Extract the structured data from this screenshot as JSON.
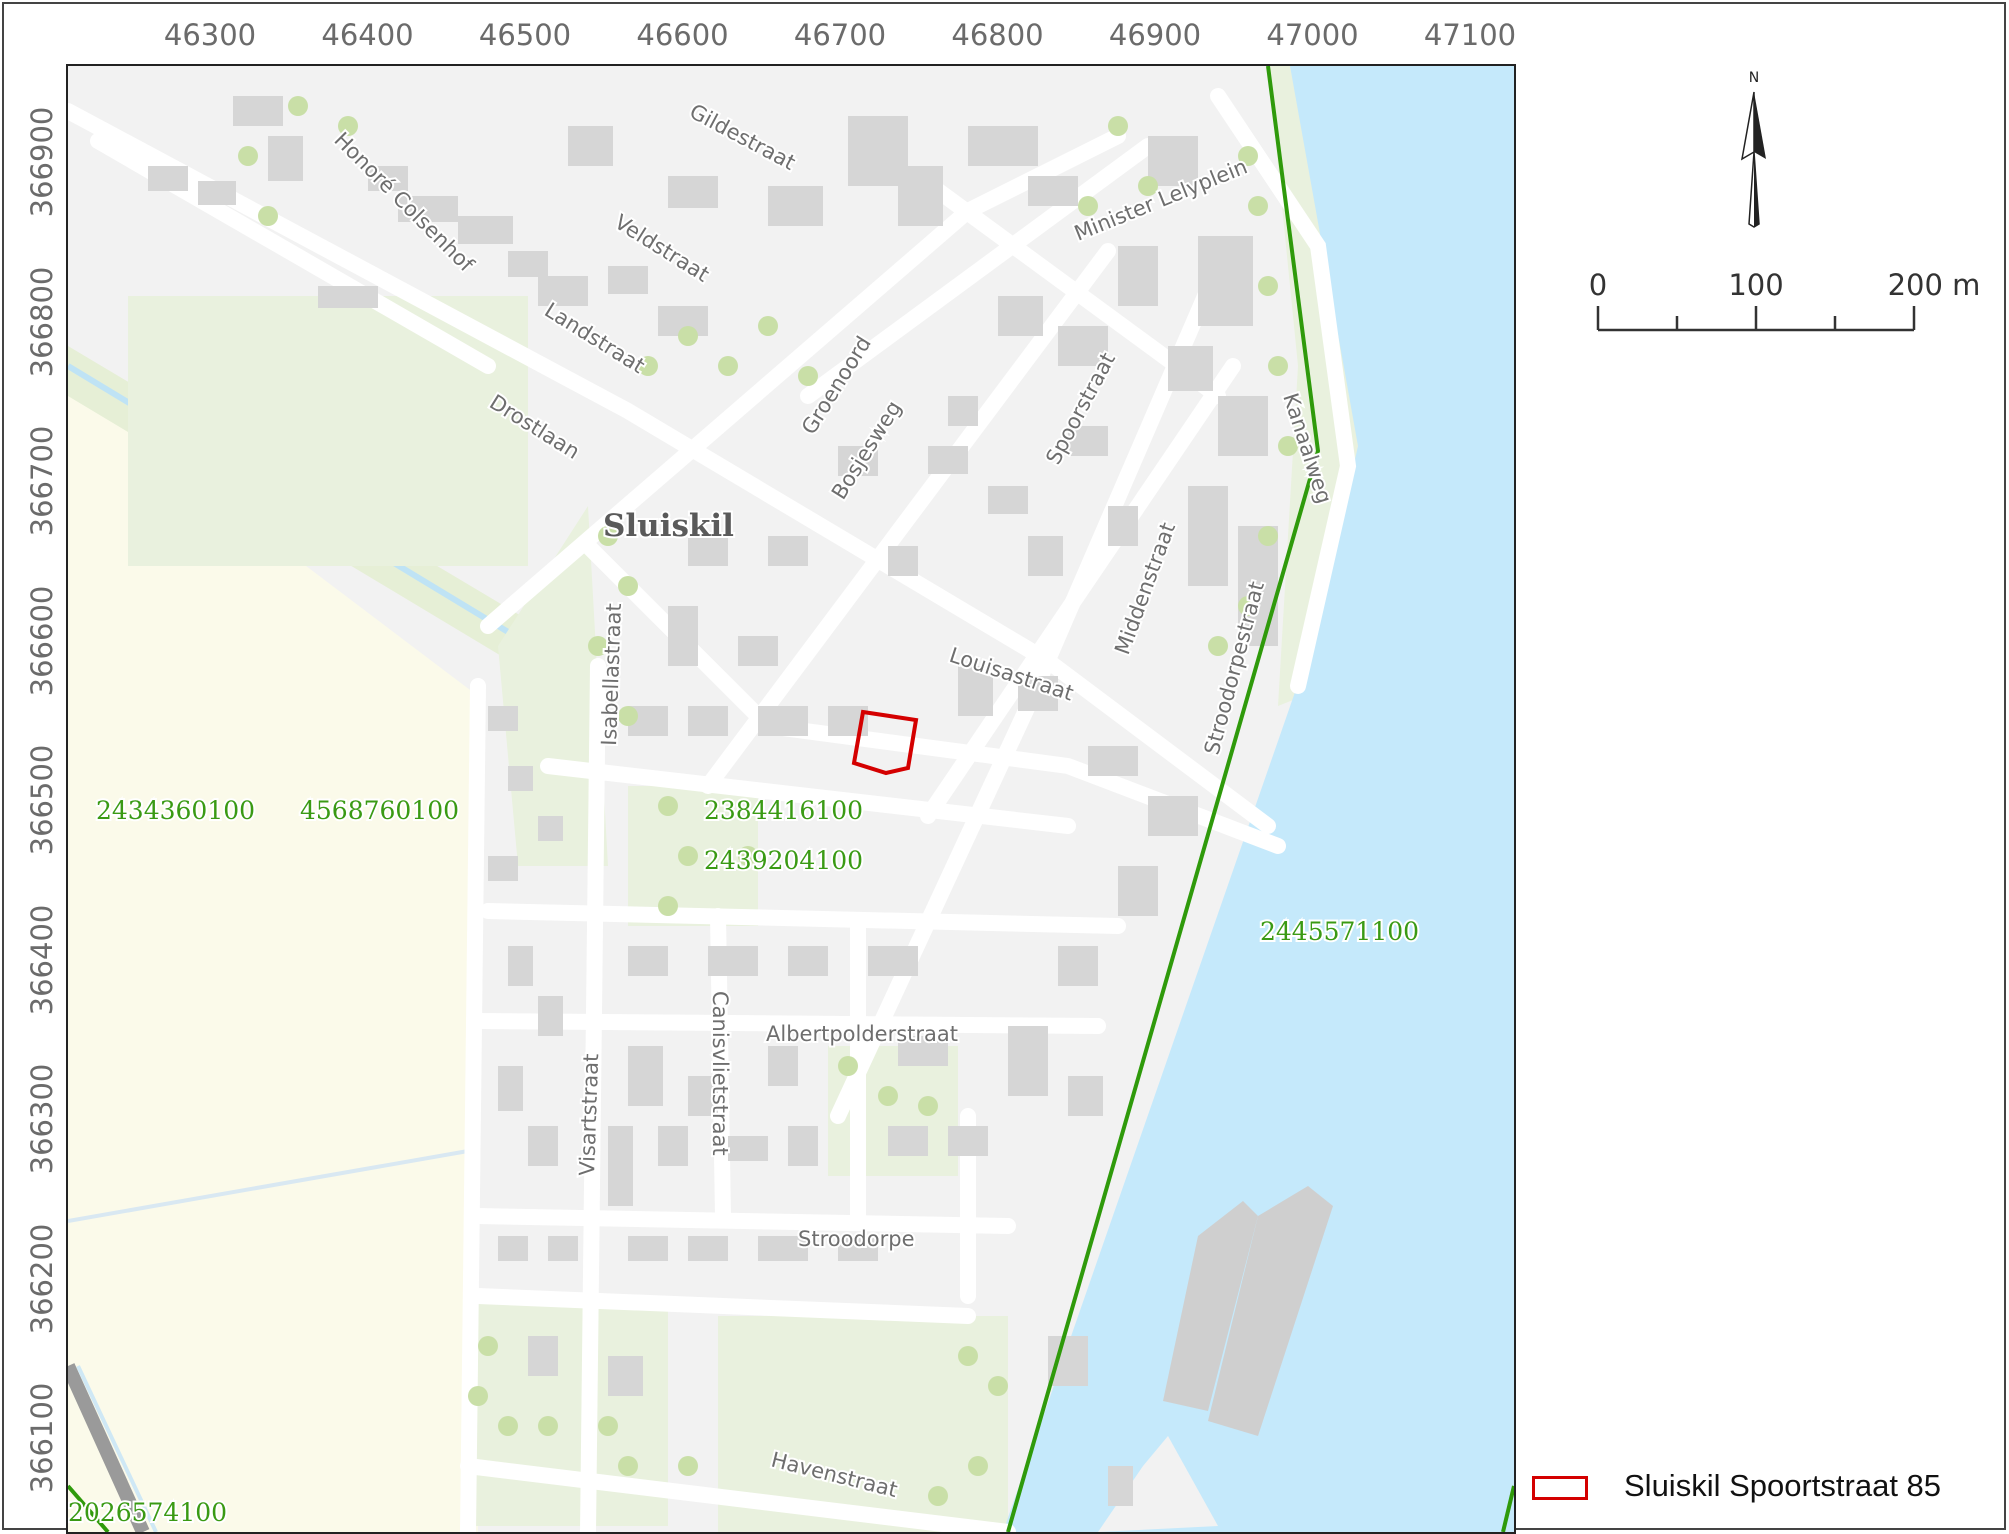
{
  "x_axis_ticks": [
    "46300",
    "46400",
    "46500",
    "46600",
    "46700",
    "46800",
    "46900",
    "47000",
    "47100"
  ],
  "y_axis_ticks": [
    "366900",
    "366800",
    "366700",
    "366600",
    "366500",
    "366400",
    "366300",
    "366200",
    "366100"
  ],
  "place_label": "Sluiskil",
  "street_labels": [
    "Gildestraat",
    "Honoré Colsenhof",
    "Veldstraat",
    "Landstraat",
    "Drostlaan",
    "Minister Lelyplein",
    "Groenoord",
    "Bosjesweg",
    "Spoorstraat",
    "Kanaalweg",
    "Middenstraat",
    "Louisastraat",
    "Isabellastraat",
    "Stroodorpestraat",
    "Visartstraat",
    "Canisvlietstraat",
    "Albertpolderstraat",
    "Stroodorpe",
    "Havenstraat"
  ],
  "parcel_labels": [
    "2434360100",
    "4568760100",
    "2384416100",
    "2439204100",
    "2445571100",
    "2026574100"
  ],
  "north_label": "N",
  "scale_labels": [
    "0",
    "100",
    "200 m"
  ],
  "legend": {
    "label": "Sluiskil Spoortstraat 85",
    "color": "#d40000"
  },
  "colors": {
    "water": "#c5e9fb",
    "built": "#f2f2f2",
    "building": "#d6d6d6",
    "park": "#e9f1de",
    "farmland": "#fbfaea",
    "tree": "#c9dfa7",
    "parcel_line": "#2f9a0b",
    "parcel_text": "#3a9a14",
    "subject": "#d40000"
  }
}
